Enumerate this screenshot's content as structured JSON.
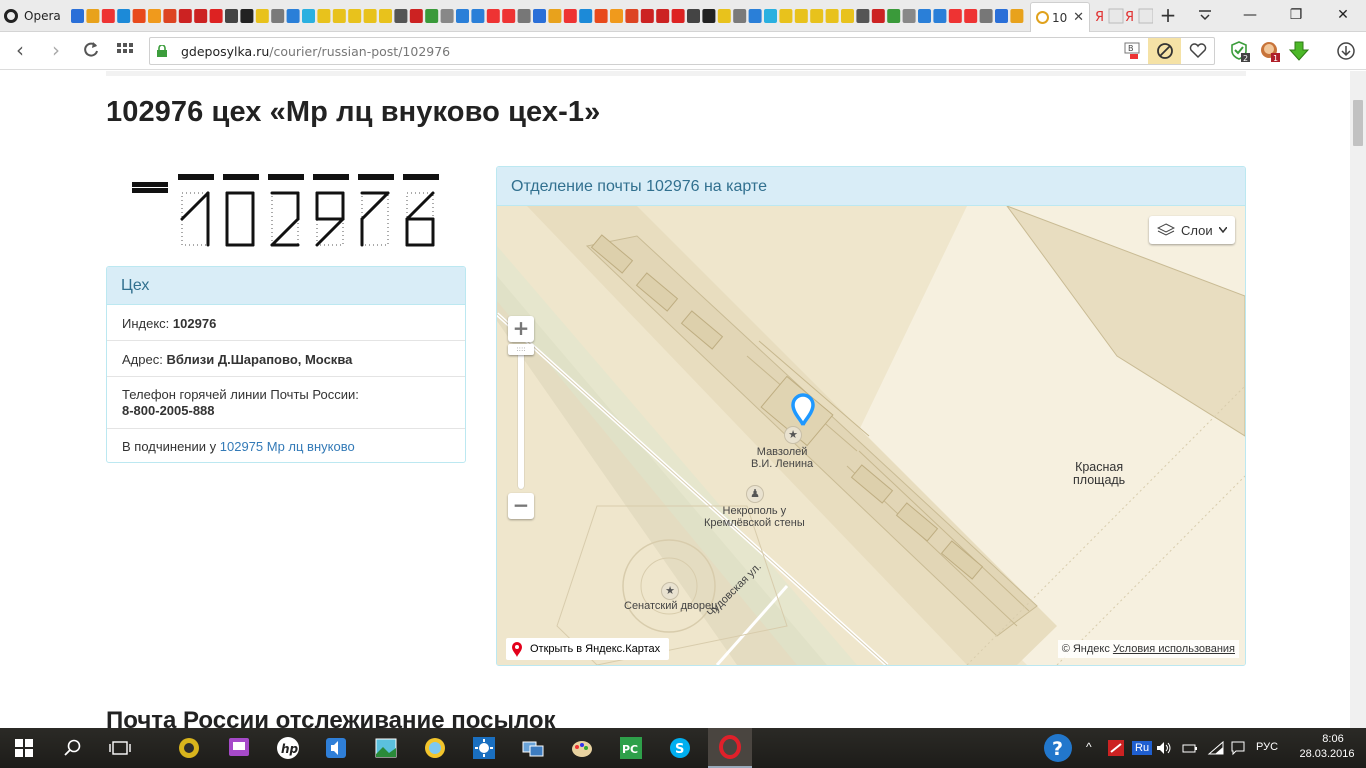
{
  "browser": {
    "app_name": "Opera",
    "active_tab_title": "10",
    "url_domain": "gdeposylka.ru",
    "url_path": "/courier/russian-post/102976",
    "colors": {
      "tab_strip": "#ebebeb",
      "secure": "#3c9d3c"
    }
  },
  "page": {
    "title": "102976 цех «Мр лц внуково цех-1»",
    "postal_code_digits": "102976",
    "info_panel": {
      "heading": "Цех",
      "index_label": "Индекс:",
      "index_value": "102976",
      "address_label": "Адрес:",
      "address_value": "Вблизи Д.Шарапово, Москва",
      "hotline_label": "Телефон горячей линии Почты России:",
      "hotline_value": "8-800-2005-888",
      "parent_label": "В подчинении у",
      "parent_link": "102975 Мр лц внуково"
    },
    "map_panel": {
      "heading": "Отделение почты 102976 на карте",
      "layers_label": "Слои",
      "open_in_yandex": "Открыть в Яндекс.Картах",
      "copyright": "© Яндекс",
      "terms_link": "Условия использования",
      "labels": {
        "mausoleum_1": "Мавзолей",
        "mausoleum_2": "В.И. Ленина",
        "necropolis_1": "Некрополь у",
        "necropolis_2": "Кремлёвской стены",
        "red_square_1": "Красная",
        "red_square_2": "площадь",
        "senate": "Сенатский дворец",
        "street": "Чудовская ул."
      }
    },
    "section_title": "Почта России отслеживание посылок"
  },
  "taskbar": {
    "lang_short": "Ru",
    "lang": "РУС",
    "time": "8:06",
    "date": "28.03.2016"
  }
}
